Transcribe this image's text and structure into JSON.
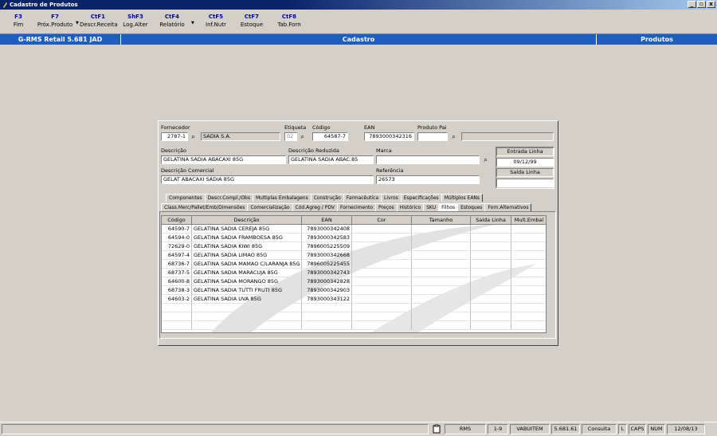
{
  "window": {
    "title": "Cadastro de Produtos"
  },
  "toolbar": [
    {
      "key": "F3",
      "label": "Fim"
    },
    {
      "key": "F7",
      "label": "Próx.Produto"
    },
    {
      "key": "CtF1",
      "label": "Descr.Receita"
    },
    {
      "key": "ShF3",
      "label": "Log.Alter"
    },
    {
      "key": "CtF4",
      "label": "Relatório"
    },
    {
      "key": "CtF5",
      "label": "Inf.Nutr"
    },
    {
      "key": "CtF7",
      "label": "Estoque"
    },
    {
      "key": "CtF8",
      "label": "Tab.Forn"
    }
  ],
  "header": {
    "app": "G-RMS Retail 5.681 JAD",
    "section": "Cadastro",
    "module": "Produtos"
  },
  "form": {
    "fornecedor_label": "Fornecedor",
    "fornecedor_code": "2787-1",
    "fornecedor_name": "SADIA S.A.",
    "etiqueta_label": "Etiqueta",
    "etiqueta_value": "02",
    "codigo_label": "Código",
    "codigo_value": "64587-7",
    "ean_label": "EAN",
    "ean_value": "7893000342316",
    "produto_pai_label": "Produto Pai",
    "produto_pai_value": "",
    "descricao_label": "Descrição",
    "descricao_value": "GELATINA SADIA ABACAXI 85G",
    "descricao_reduzida_label": "Descrição Reduzida",
    "descricao_reduzida_value": "GELATINA SADIA ABAC.85",
    "marca_label": "Marca",
    "marca_value": "",
    "descricao_comercial_label": "Descrição Comercial",
    "descricao_comercial_value": "GELAT ABACAXI  SADIA    85G",
    "referencia_label": "Referência",
    "referencia_value": "26573",
    "entrada_linha_label": "Entrada Linha",
    "entrada_linha_value": "09/12/99",
    "saida_linha_label": "Saída Linha",
    "saida_linha_value": ""
  },
  "tabs_row1": [
    "Componentes",
    "Descr.Compl./Obs",
    "Multiplas Embalagens",
    "Construção",
    "Farmacêutica",
    "Livros",
    "Especificações",
    "Múltiplos EANs"
  ],
  "tabs_row2": [
    "Class.Merc/Pallet/Emb/Dimensões",
    "Comercialização",
    "Cód.Agreg / PDV",
    "Fornecimento",
    "Preços",
    "Histórico",
    "SKU",
    "Filhos",
    "Estoques",
    "Forn.Alternativos"
  ],
  "active_tab": "Filhos",
  "table": {
    "columns": [
      "Código",
      "Descrição",
      "EAN",
      "Cor",
      "Tamanho",
      "Saída Linha",
      "Mult.Embal"
    ],
    "rows": [
      [
        "64590-7",
        "GELATINA SADIA CEREJA 85G",
        "7893000342408"
      ],
      [
        "64594-0",
        "GELATINA SADIA FRAMBOESA 85G",
        "7893000342583"
      ],
      [
        "72629-0",
        "GELATINA SADIA KIWI 85G",
        "7896005225509"
      ],
      [
        "64597-4",
        "GELATINA SADIA LIMAO 85G",
        "7893000342668"
      ],
      [
        "68736-7",
        "GELATINA SADIA MAMAO C/LARANJA 85G",
        "7896005225455"
      ],
      [
        "68737-5",
        "GELATINA SADIA MARACUJA 85G",
        "7893000342743"
      ],
      [
        "64600-8",
        "GELATINA SADIA MORANGO 85G",
        "7893000342828"
      ],
      [
        "68738-3",
        "GELATINA SADIA TUTTI FRUTI 85G",
        "7893000342903"
      ],
      [
        "64603-2",
        "GELATINA SADIA UVA 85G",
        "7893000343122"
      ]
    ]
  },
  "statusbar": [
    "RMS",
    "1-9",
    "VABUITEM",
    "5.681.61",
    "Consulta",
    "L",
    "CAPS",
    "NUM",
    "12/08/13"
  ]
}
